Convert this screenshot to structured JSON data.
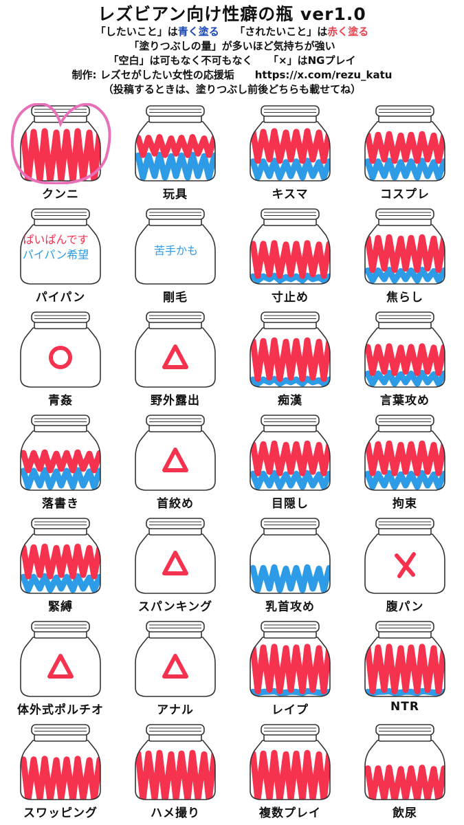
{
  "header": {
    "title": "レズビアン向け性癖の瓶 ver1.0",
    "line1": {
      "p1": "「したいこと」は",
      "blue": "青く塗る",
      "gap": "　　",
      "p2": "「されたいこと」は",
      "red": "赤く塗る"
    },
    "line2": "「塗りつぶしの量」が多いほど気持ちが強い",
    "line3": "「空白」は可もなく不可もなく　　「×」はNGプレイ",
    "line4": "制作: レズセがしたい女性の応援垢　　https://x.com/rezu_katu",
    "line5": "（投稿するときは、塗りつぶし前後どちらも載せてね）"
  },
  "colors": {
    "red": "#f5334f",
    "blue": "#2d9be6",
    "pink": "#e870b8",
    "jar": "#333333"
  },
  "jars": [
    {
      "label": "クンニ",
      "red": 0.85,
      "blue": 0,
      "mark": "heart-circle"
    },
    {
      "label": "玩具",
      "red": 0.3,
      "blue": 0.45
    },
    {
      "label": "キスマ",
      "red": 0.5,
      "blue": 0.35
    },
    {
      "label": "コスプレ",
      "red": 0.45,
      "blue": 0.35
    },
    {
      "label": "パイパン",
      "note": [
        "ぱいぱんです",
        "パイパン希望"
      ]
    },
    {
      "label": "剛毛",
      "note": [
        "苦手かも"
      ]
    },
    {
      "label": "寸止め",
      "red": 0.55,
      "blue": 0.15
    },
    {
      "label": "焦らし",
      "red": 0.55,
      "blue": 0.25
    },
    {
      "label": "青姦",
      "mark": "circle"
    },
    {
      "label": "野外露出",
      "mark": "triangle"
    },
    {
      "label": "痴漢",
      "red": 0.65,
      "blue": 0.15
    },
    {
      "label": "言葉攻め",
      "red": 0.45,
      "blue": 0.25
    },
    {
      "label": "落書き",
      "red": 0.3,
      "blue": 0.35
    },
    {
      "label": "首絞め",
      "mark": "triangle"
    },
    {
      "label": "目隠し",
      "red": 0.5,
      "blue": 0.3
    },
    {
      "label": "拘束",
      "red": 0.5,
      "blue": 0.3
    },
    {
      "label": "緊縛",
      "red": 0.5,
      "blue": 0.3
    },
    {
      "label": "スパンキング",
      "mark": "triangle"
    },
    {
      "label": "乳首攻め",
      "red": 0,
      "blue": 0.45
    },
    {
      "label": "腹パン",
      "mark": "x"
    },
    {
      "label": "体外式ポルチオ",
      "mark": "triangle"
    },
    {
      "label": "アナル",
      "mark": "triangle"
    },
    {
      "label": "レイプ",
      "red": 0.75,
      "blue": 0.1
    },
    {
      "label": "NTR",
      "red": 0.75,
      "blue": 0.1
    },
    {
      "label": "スワッピング",
      "red": 0.7,
      "blue": 0
    },
    {
      "label": "ハメ撮り",
      "red": 0.8,
      "blue": 0
    },
    {
      "label": "複数プレイ",
      "red": 0.8,
      "blue": 0
    },
    {
      "label": "飲尿",
      "red": 0.55,
      "blue": 0
    }
  ]
}
